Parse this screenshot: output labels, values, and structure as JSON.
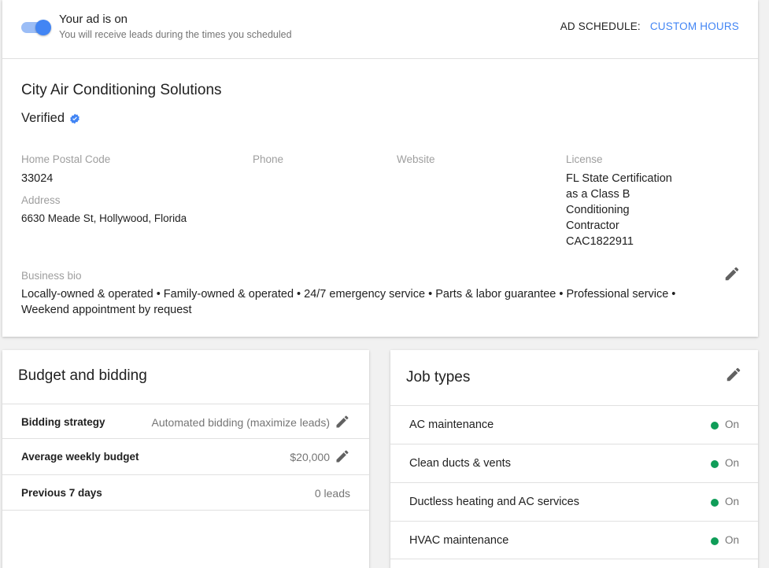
{
  "status": {
    "title": "Your ad is on",
    "subtitle": "You will receive leads during the times you scheduled",
    "schedule_label": "AD SCHEDULE:",
    "schedule_link": "CUSTOM HOURS",
    "toggle_on": true
  },
  "business": {
    "name": "City Air Conditioning Solutions",
    "verified_label": "Verified",
    "postal_label": "Home Postal Code",
    "postal_value": "33024",
    "address_label": "Address",
    "address_value": "6630 Meade St, Hollywood, Florida",
    "phone_label": "Phone",
    "website_label": "Website",
    "license_label": "License",
    "license_lines": [
      "FL State Certification",
      "as a Class B",
      "Conditioning",
      "Contractor",
      "CAC1822911"
    ],
    "bio_label": "Business bio",
    "bio_text": "Locally-owned & operated • Family-owned & operated • 24/7 emergency service • Parts & labor guarantee • Professional service • Weekend appointment by request"
  },
  "budget": {
    "title": "Budget and bidding",
    "rows": [
      {
        "key": "Bidding strategy",
        "value": "Automated bidding (maximize leads)"
      },
      {
        "key": "Average weekly budget",
        "value": "$20,000"
      },
      {
        "key": "Previous 7 days",
        "value": "0 leads"
      }
    ]
  },
  "jobs": {
    "title": "Job types",
    "rows": [
      {
        "name": "AC maintenance",
        "status": "On"
      },
      {
        "name": "Clean ducts & vents",
        "status": "On"
      },
      {
        "name": "Ductless heating and AC services",
        "status": "On"
      },
      {
        "name": "HVAC maintenance",
        "status": "On"
      }
    ]
  },
  "colors": {
    "accent": "#4285f4",
    "status_on": "#0f9d58",
    "muted_text": "#757575"
  },
  "icons": {
    "edit": "pencil-icon",
    "verified": "verified-badge-icon"
  }
}
